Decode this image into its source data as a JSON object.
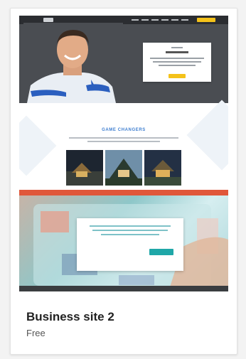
{
  "template": {
    "name": "Business site 2",
    "price": "Free"
  },
  "preview": {
    "section_title": "GAME CHANGERS"
  },
  "colors": {
    "accent_yellow": "#f4c21a",
    "heading_blue": "#3f7fd0",
    "teal": "#1fa7a8",
    "hero_dark": "#4a4d52"
  }
}
